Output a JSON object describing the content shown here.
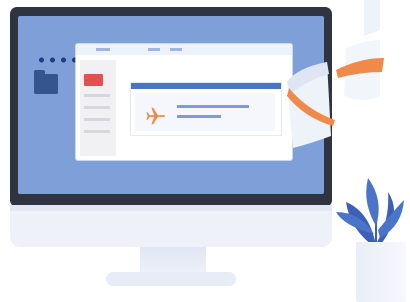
{
  "illustration": {
    "icons": [
      "folder-icon",
      "mail-icon",
      "airplane-icon",
      "plant-icon"
    ],
    "colors": {
      "monitor_frame": "#2f3440",
      "screen_background": "#7f9fd8",
      "window_accent": "#4a74c8",
      "airplane": "#f08a4b",
      "mail": "#e2504f",
      "leaf": "#3d5fb8",
      "paper_accent": "#f08a4b"
    }
  }
}
